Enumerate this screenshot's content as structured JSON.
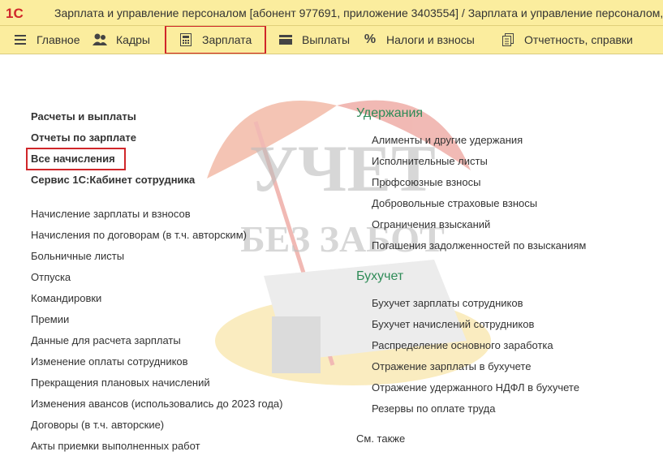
{
  "titlebar": {
    "logo_text": "1С",
    "title": "Зарплата и управление персоналом [абонент 977691, приложение 3403554] / Зарплата и управление персоналом, ред"
  },
  "sections": [
    {
      "label": "Главное",
      "icon": "menu-lines-icon"
    },
    {
      "label": "Кадры",
      "icon": "people-icon"
    },
    {
      "label": "Зарплата",
      "icon": "calculator-icon"
    },
    {
      "label": "Выплаты",
      "icon": "card-icon"
    },
    {
      "label": "Налоги и взносы",
      "icon": "percent-icon"
    },
    {
      "label": "Отчетность, справки",
      "icon": "documents-icon"
    }
  ],
  "left_bold": [
    "Расчеты и выплаты",
    "Отчеты по зарплате",
    "Все начисления",
    "Сервис 1С:Кабинет сотрудника"
  ],
  "left_items": [
    "Начисление зарплаты и взносов",
    "Начисления по договорам (в т.ч. авторским)",
    "Больничные листы",
    "Отпуска",
    "Командировки",
    "Премии",
    "Данные для расчета зарплаты",
    "Изменение оплаты сотрудников",
    "Прекращения плановых начислений",
    "Изменения авансов (использовались до 2023 года)",
    "Договоры (в т.ч. авторские)",
    "Акты приемки выполненных работ"
  ],
  "deductions": {
    "heading": "Удержания",
    "items": [
      "Алименты и другие удержания",
      "Исполнительные листы",
      "Профсоюзные взносы",
      "Добровольные страховые взносы",
      "Ограничения взысканий",
      "Погашения задолженностей по взысканиям"
    ]
  },
  "accounting": {
    "heading": "Бухучет",
    "items": [
      "Бухучет зарплаты сотрудников",
      "Бухучет начислений сотрудников",
      "Распределение основного заработка",
      "Отражение зарплаты в бухучете",
      "Отражение удержанного НДФЛ в бухучете",
      "Резервы по оплате труда"
    ]
  },
  "see_also": "См. также",
  "watermark": {
    "line1": "УЧЕТ",
    "line2": "БЕЗ ЗАБОТ"
  },
  "colors": {
    "bar": "#fbed9e",
    "accent_red": "#d0262a",
    "heading_green": "#2e8b57"
  }
}
